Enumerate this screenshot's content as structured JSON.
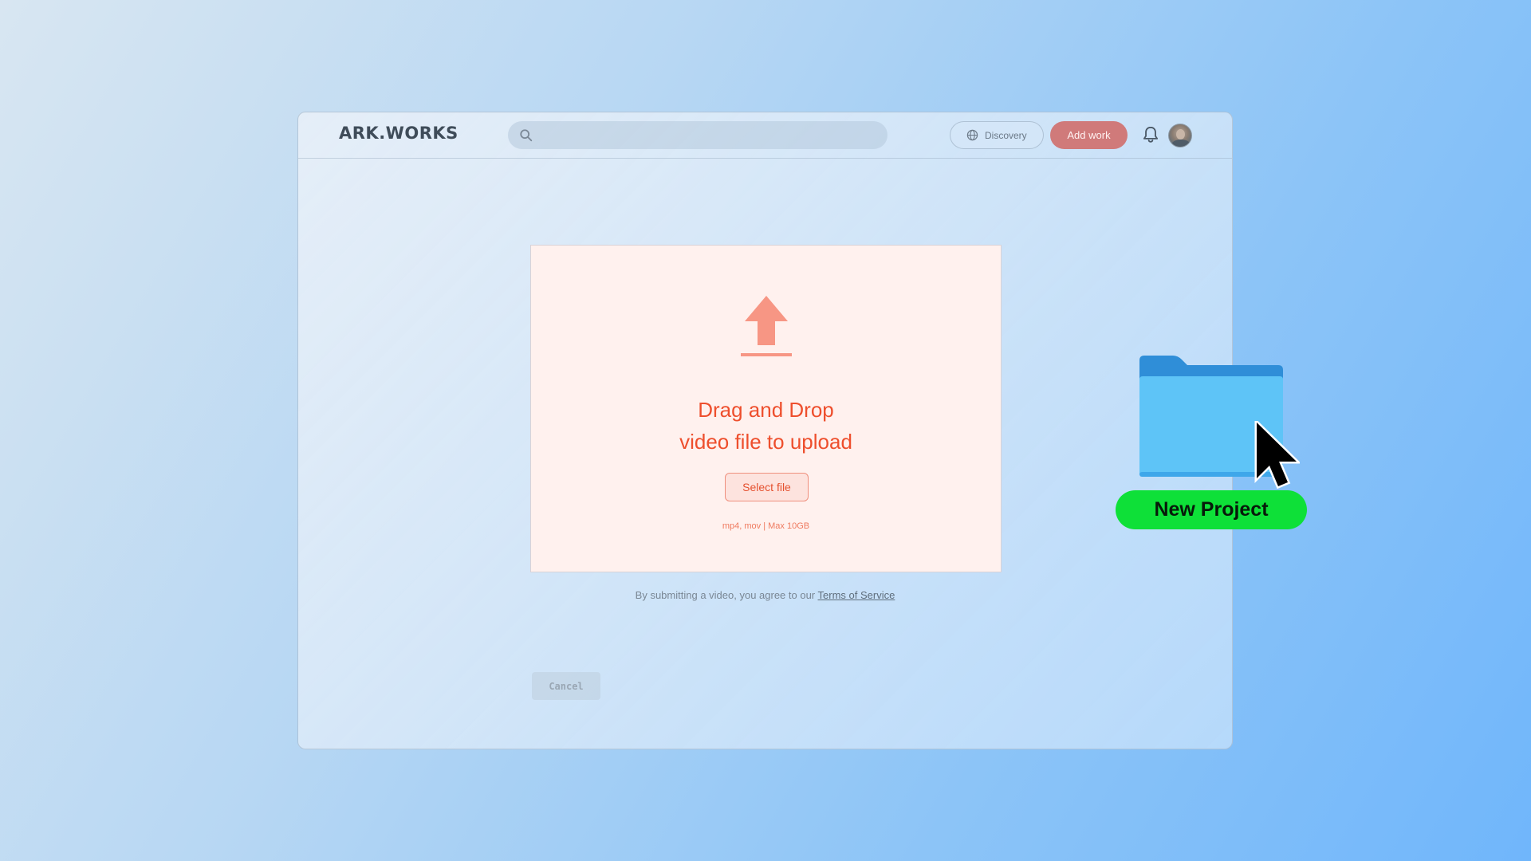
{
  "app": {
    "logo": "ARK.WORKS"
  },
  "header": {
    "search_placeholder": "",
    "discovery_label": "Discovery",
    "add_work_label": "Add work"
  },
  "upload": {
    "title_line1": "Drag and Drop",
    "title_line2": "video file to upload",
    "select_file_label": "Select file",
    "formats_note": "mp4, mov | Max 10GB"
  },
  "terms": {
    "prefix": "By submitting a video, you agree to our ",
    "link_label": "Terms of Service"
  },
  "footer": {
    "cancel_label": "Cancel"
  },
  "desktop": {
    "folder_label": "New Project"
  },
  "icons": {
    "search": "search-icon",
    "globe": "globe-icon",
    "bell": "bell-icon",
    "upload": "upload-arrow-icon",
    "folder": "folder-icon",
    "cursor": "mouse-pointer-icon"
  },
  "colors": {
    "accent": "#ee4f2d",
    "add_work_bg": "#d07a7a",
    "card_bg": "#fff1ee",
    "folder_blue": "#5ec4f7",
    "label_green": "#0ee038"
  }
}
